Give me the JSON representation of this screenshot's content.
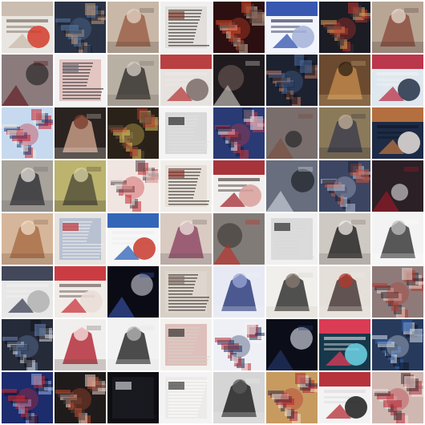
{
  "image": {
    "kind": "generated-sample-grid",
    "rows": 8,
    "cols": 8,
    "tiles": [
      {
        "bg": "#e9e6e1",
        "c": [
          "#c8b8aa",
          "#d43b2c",
          "#6e5f54"
        ],
        "style": "poster"
      },
      {
        "bg": "#2a3346",
        "c": [
          "#5678a6",
          "#c69a7a",
          "#1a2030"
        ],
        "style": "busy"
      },
      {
        "bg": "#c9b8a7",
        "c": [
          "#9a5b42",
          "#e3d3c4",
          "#4a3a33"
        ],
        "style": "figure"
      },
      {
        "bg": "#efefef",
        "c": [
          "#7a3426",
          "#b9aba0",
          "#2c2523"
        ],
        "style": "page"
      },
      {
        "bg": "#2b0f11",
        "c": [
          "#d9472a",
          "#d7c0a7",
          "#5a3f3a"
        ],
        "style": "busy"
      },
      {
        "bg": "#f2f4fb",
        "c": [
          "#2446a8",
          "#a5b1d8",
          "#1c2144"
        ],
        "style": "poster"
      },
      {
        "bg": "#1b1c24",
        "c": [
          "#c0332b",
          "#d6a25a",
          "#3a2d36"
        ],
        "style": "busy"
      },
      {
        "bg": "#b8a695",
        "c": [
          "#8b4a3a",
          "#e6dbd0",
          "#3a2a27"
        ],
        "style": "figure"
      },
      {
        "bg": "#2f0a0f",
        "c": [
          "#5a1118",
          "#1a1a1a",
          "#d8d8d8"
        ],
        "style": "dark"
      },
      {
        "bg": "#f3f3f3",
        "c": [
          "#6c6c74",
          "#b43a2a",
          "#2b2b31"
        ],
        "style": "page"
      },
      {
        "bg": "#b9b0a4",
        "c": [
          "#2d2a28",
          "#d8d0c7",
          "#6c5f57"
        ],
        "style": "figure"
      },
      {
        "bg": "#e6e2df",
        "c": [
          "#b42f2f",
          "#7a6b68",
          "#efe8e6"
        ],
        "style": "poster"
      },
      {
        "bg": "#111014",
        "c": [
          "#d8d2cc",
          "#6e5b55",
          "#2a2327"
        ],
        "style": "dark"
      },
      {
        "bg": "#1d2230",
        "c": [
          "#4b6ea3",
          "#c47a5e",
          "#111017"
        ],
        "style": "busy"
      },
      {
        "bg": "#6b4a2f",
        "c": [
          "#c58a4c",
          "#2e2013",
          "#e5c48c"
        ],
        "style": "figure"
      },
      {
        "bg": "#dfe8ee",
        "c": [
          "#b7233a",
          "#243046",
          "#f0f2f4"
        ],
        "style": "poster"
      },
      {
        "bg": "#c7d9ef",
        "c": [
          "#c41f2a",
          "#1d3c73",
          "#efe5dc"
        ],
        "style": "busy"
      },
      {
        "bg": "#2a2320",
        "c": [
          "#d2a78e",
          "#7a3a2b",
          "#f0e6df"
        ],
        "style": "figure"
      },
      {
        "bg": "#2a2218",
        "c": [
          "#e2c35f",
          "#b33b2e",
          "#5d4a3b"
        ],
        "style": "busy"
      },
      {
        "bg": "#f4f4f4",
        "c": [
          "#1b1b1b",
          "#888",
          "#e0e0e0"
        ],
        "style": "page"
      },
      {
        "bg": "#2a3a74",
        "c": [
          "#c8363d",
          "#e3e4ee",
          "#1a1d3a"
        ],
        "style": "busy"
      },
      {
        "bg": "#2d3140",
        "c": [
          "#7b4b3b",
          "#1a1b20",
          "#b8a08f"
        ],
        "style": "dark"
      },
      {
        "bg": "#8b7a5a",
        "c": [
          "#3a3b4b",
          "#c5b29b",
          "#22252e"
        ],
        "style": "figure"
      },
      {
        "bg": "#1d2b46",
        "c": [
          "#c5773f",
          "#e7e0db",
          "#101622"
        ],
        "style": "poster"
      },
      {
        "bg": "#a8a39b",
        "c": [
          "#2c2d33",
          "#e6e2db",
          "#5c5c64"
        ],
        "style": "figure"
      },
      {
        "bg": "#bcb36f",
        "c": [
          "#4e4a37",
          "#d8d3a4",
          "#2b2a24"
        ],
        "style": "figure"
      },
      {
        "bg": "#f1e5e1",
        "c": [
          "#c2262b",
          "#4a4147",
          "#efe1da"
        ],
        "style": "busy"
      },
      {
        "bg": "#f1eeea",
        "c": [
          "#8a2b23",
          "#c9b2a0",
          "#2f2926"
        ],
        "style": "page"
      },
      {
        "bg": "#f0efee",
        "c": [
          "#9e1f26",
          "#d9a09c",
          "#3b2c2a"
        ],
        "style": "poster"
      },
      {
        "bg": "#2a2f3c",
        "c": [
          "#d9dde6",
          "#111318",
          "#9aa3b4"
        ],
        "style": "dark"
      },
      {
        "bg": "#3c4562",
        "c": [
          "#b7bfd6",
          "#c2533f",
          "#1a2035"
        ],
        "style": "busy"
      },
      {
        "bg": "#171219",
        "c": [
          "#a31b28",
          "#e3e1e4",
          "#3d2b32"
        ],
        "style": "dark"
      },
      {
        "bg": "#d6b69b",
        "c": [
          "#a66a43",
          "#f0dcc7",
          "#6a4a33"
        ],
        "style": "figure"
      },
      {
        "bg": "#e7e3e0",
        "c": [
          "#c1292e",
          "#2c5aa3",
          "#f1efed"
        ],
        "style": "page"
      },
      {
        "bg": "#f7f7f7",
        "c": [
          "#1e55b0",
          "#c93a2e",
          "#ececec"
        ],
        "style": "poster"
      },
      {
        "bg": "#d9cbc1",
        "c": [
          "#8b3f5f",
          "#efe5df",
          "#5b4a57"
        ],
        "style": "figure"
      },
      {
        "bg": "#1a1514",
        "c": [
          "#c22a24",
          "#3a3331",
          "#d7cfc9"
        ],
        "style": "dark"
      },
      {
        "bg": "#f0f0f0",
        "c": [
          "#1e1e1e",
          "#9a9a9a",
          "#d8d8d8"
        ],
        "style": "page"
      },
      {
        "bg": "#cfc9c3",
        "c": [
          "#1a1a1a",
          "#efebe8",
          "#6b605b"
        ],
        "style": "figure"
      },
      {
        "bg": "#f3f3f3",
        "c": [
          "#2a2a2a",
          "#bfbfbf",
          "#ffffff"
        ],
        "style": "figure"
      },
      {
        "bg": "#e7e7e7",
        "c": [
          "#30354a",
          "#b1b1b1",
          "#f1f1f1"
        ],
        "style": "poster"
      },
      {
        "bg": "#f1ece8",
        "c": [
          "#c62930",
          "#eaded6",
          "#5a4b45"
        ],
        "style": "poster"
      },
      {
        "bg": "#0c0d1d",
        "c": [
          "#3a57b3",
          "#d2d2de",
          "#0b0b0f"
        ],
        "style": "dark"
      },
      {
        "bg": "#d8cfc6",
        "c": [
          "#7e6f67",
          "#f0ebe6",
          "#2d2624"
        ],
        "style": "page"
      },
      {
        "bg": "#e7eaf4",
        "c": [
          "#1f2f73",
          "#9ba7d6",
          "#f3f4f8"
        ],
        "style": "figure"
      },
      {
        "bg": "#f1efeb",
        "c": [
          "#222",
          "#8a7a72",
          "#d4c7bf"
        ],
        "style": "figure"
      },
      {
        "bg": "#e5dfd9",
        "c": [
          "#3c2c2a",
          "#b4372c",
          "#f0ebe7"
        ],
        "style": "figure"
      },
      {
        "bg": "#8f7a7a",
        "c": [
          "#b43a2f",
          "#e8d7cf",
          "#2f2a33"
        ],
        "style": "busy"
      },
      {
        "bg": "#262b3a",
        "c": [
          "#6a86b8",
          "#d8d8dd",
          "#101219"
        ],
        "style": "busy"
      },
      {
        "bg": "#f1efee",
        "c": [
          "#b01e2b",
          "#f7e8e5",
          "#5b4b49"
        ],
        "style": "figure"
      },
      {
        "bg": "#f2f2f2",
        "c": [
          "#1c1c1c",
          "#b8b8b8",
          "#dedede"
        ],
        "style": "figure"
      },
      {
        "bg": "#f3f1ee",
        "c": [
          "#292727",
          "#a12b22",
          "#d5cfc8"
        ],
        "style": "page"
      },
      {
        "bg": "#eef0f6",
        "c": [
          "#1f2d5a",
          "#b62b31",
          "#f6f6f6"
        ],
        "style": "busy"
      },
      {
        "bg": "#07090f",
        "c": [
          "#273b73",
          "#e7edf7",
          "#0e1020"
        ],
        "style": "dark"
      },
      {
        "bg": "#17384b",
        "c": [
          "#f13c57",
          "#6fd5e8",
          "#e6e6e6"
        ],
        "style": "poster"
      },
      {
        "bg": "#283a5c",
        "c": [
          "#d7e0ef",
          "#2f63b3",
          "#0f1523"
        ],
        "style": "busy"
      },
      {
        "bg": "#1c2c6c",
        "c": [
          "#d2292d",
          "#9ab5ea",
          "#0f1533"
        ],
        "style": "busy"
      },
      {
        "bg": "#201b1b",
        "c": [
          "#c14c2d",
          "#f0d3c8",
          "#4b3a36"
        ],
        "style": "busy"
      },
      {
        "bg": "#0d0d12",
        "c": [
          "#d9d9df",
          "#3a3a48",
          "#1a1a24"
        ],
        "style": "page"
      },
      {
        "bg": "#f3f3f3",
        "c": [
          "#2f2f2f",
          "#d9d2cb",
          "#ffffff"
        ],
        "style": "page"
      },
      {
        "bg": "#d5d5d5",
        "c": [
          "#121212",
          "#5a5a5a",
          "#f0f0f0"
        ],
        "style": "figure"
      },
      {
        "bg": "#c79b5f",
        "c": [
          "#b5222c",
          "#2e2a45",
          "#efe2cf"
        ],
        "style": "busy"
      },
      {
        "bg": "#f3f3f3",
        "c": [
          "#b01e27",
          "#1b1b1b",
          "#dadada"
        ],
        "style": "poster"
      },
      {
        "bg": "#cfb8b1",
        "c": [
          "#b62834",
          "#3c2f31",
          "#efe2dd"
        ],
        "style": "busy"
      }
    ]
  }
}
